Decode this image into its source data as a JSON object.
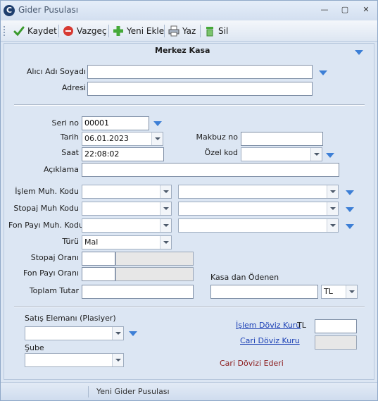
{
  "window": {
    "title": "Gider Pusulası",
    "min": "—",
    "max": "▢",
    "close": "✕"
  },
  "toolbar": {
    "save": "Kaydet",
    "cancel": "Vazgeç",
    "new": "Yeni Ekle",
    "print": "Yaz",
    "delete": "Sil"
  },
  "header": {
    "title": "Merkez Kasa"
  },
  "recipient": {
    "name_label": "Alıcı Adı Soyadı",
    "name_value": "",
    "address_label": "Adresi",
    "address_value": ""
  },
  "form": {
    "seri_label": "Seri no",
    "seri_value": "00001",
    "tarih_label": "Tarih",
    "tarih_value": "06.01.2023",
    "saat_label": "Saat",
    "saat_value": "22:08:02",
    "makbuz_label": "Makbuz no",
    "makbuz_value": "",
    "ozel_label": "Özel kod",
    "ozel_value": "",
    "aciklama_label": "Açıklama",
    "aciklama_value": "",
    "islem_muh_label": "İşlem Muh. Kodu",
    "stopaj_muh_label": "Stopaj Muh Kodu",
    "fon_muh_label": "Fon Payı Muh. Kodu",
    "turu_label": "Türü",
    "turu_value": "Mal",
    "stopaj_orani_label": "Stopaj Oranı",
    "fon_orani_label": "Fon Payı Oranı",
    "toplam_label": "Toplam Tutar",
    "toplam_value": "",
    "kasa_label": "Kasa dan Ödenen",
    "kasa_value": "",
    "currency": "TL"
  },
  "bottom": {
    "satis_label": "Satış Elemanı (Plasiyer)",
    "sube_label": "Şube",
    "islem_doviz_label": "İşlem Döviz Kuru",
    "islem_doviz_currency": "TL",
    "cari_doviz_label": "Cari Döviz Kuru",
    "cari_doviz_ederi": "Cari Dövizi Ederi"
  },
  "status": {
    "text": "Yeni Gider Pusulası"
  },
  "colors": {
    "accent": "#3d7fd6",
    "link": "#1a3fb5",
    "ederi": "#8b1a1a"
  }
}
